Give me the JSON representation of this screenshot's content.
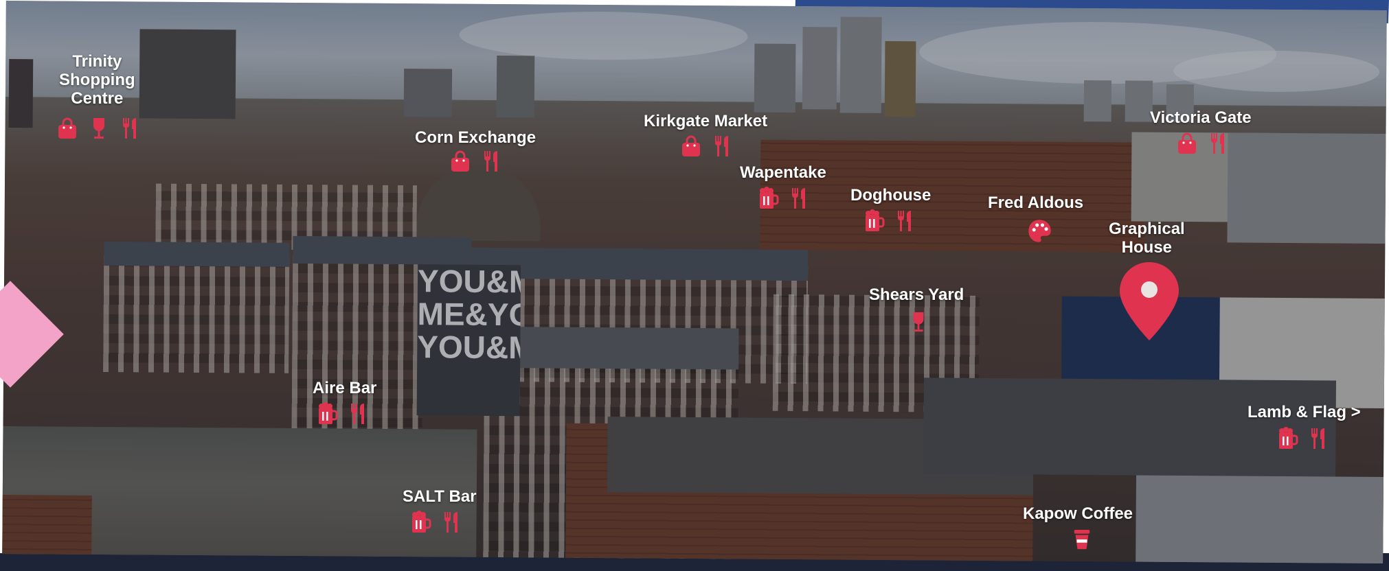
{
  "colors": {
    "accent": "#e0334f",
    "label": "#ffffff",
    "navy": "#2c4b8e",
    "pink": "#f2a3c7"
  },
  "mural": {
    "lines": [
      "YOU&ME",
      "ME&YOU",
      "YOU&ME"
    ]
  },
  "places": [
    {
      "id": "trinity",
      "lines": [
        "Trinity",
        "Shopping",
        "Centre"
      ],
      "icons": [
        "shopping-bag-icon",
        "wine-glass-icon",
        "cutlery-icon"
      ]
    },
    {
      "id": "corn-exchange",
      "lines": [
        "Corn Exchange"
      ],
      "icons": [
        "shopping-bag-icon",
        "cutlery-icon"
      ]
    },
    {
      "id": "kirkgate",
      "lines": [
        "Kirkgate Market"
      ],
      "icons": [
        "shopping-bag-icon",
        "cutlery-icon"
      ]
    },
    {
      "id": "victoria-gate",
      "lines": [
        "Victoria Gate"
      ],
      "icons": [
        "shopping-bag-icon",
        "cutlery-icon"
      ]
    },
    {
      "id": "wapentake",
      "lines": [
        "Wapentake"
      ],
      "icons": [
        "beer-mug-icon",
        "cutlery-icon"
      ]
    },
    {
      "id": "doghouse",
      "lines": [
        "Doghouse"
      ],
      "icons": [
        "beer-mug-icon",
        "cutlery-icon"
      ]
    },
    {
      "id": "fred-aldous",
      "lines": [
        "Fred Aldous"
      ],
      "icons": [
        "palette-icon"
      ]
    },
    {
      "id": "graphical-house",
      "lines": [
        "Graphical",
        "House"
      ],
      "icons": [
        "location-pin-icon"
      ]
    },
    {
      "id": "shears-yard",
      "lines": [
        "Shears Yard"
      ],
      "icons": [
        "wine-glass-icon"
      ]
    },
    {
      "id": "aire-bar",
      "lines": [
        "Aire Bar"
      ],
      "icons": [
        "beer-mug-icon",
        "cutlery-icon"
      ]
    },
    {
      "id": "lamb-flag",
      "lines": [
        "Lamb & Flag >"
      ],
      "icons": [
        "beer-mug-icon",
        "cutlery-icon"
      ]
    },
    {
      "id": "salt-bar",
      "lines": [
        "SALT Bar"
      ],
      "icons": [
        "beer-mug-icon",
        "cutlery-icon"
      ]
    },
    {
      "id": "kapow",
      "lines": [
        "Kapow Coffee"
      ],
      "icons": [
        "coffee-cup-icon"
      ]
    }
  ]
}
